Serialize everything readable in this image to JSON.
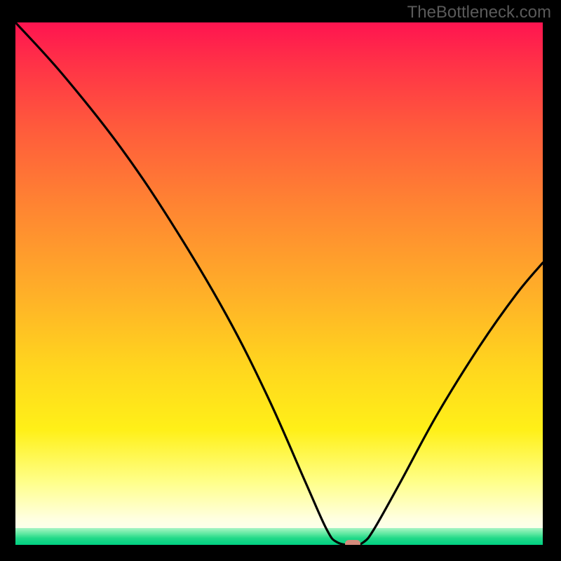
{
  "attribution": "TheBottleneck.com",
  "chart_data": {
    "type": "line",
    "title": "",
    "xlabel": "",
    "ylabel": "",
    "xlim": [
      0,
      100
    ],
    "ylim": [
      0,
      100
    ],
    "curve": [
      {
        "x": 0,
        "y": 100
      },
      {
        "x": 9,
        "y": 90
      },
      {
        "x": 20,
        "y": 76
      },
      {
        "x": 30,
        "y": 61
      },
      {
        "x": 40,
        "y": 44
      },
      {
        "x": 48,
        "y": 28
      },
      {
        "x": 55,
        "y": 12
      },
      {
        "x": 59,
        "y": 3
      },
      {
        "x": 61,
        "y": 0.5
      },
      {
        "x": 64,
        "y": 0
      },
      {
        "x": 66,
        "y": 0.5
      },
      {
        "x": 68,
        "y": 3
      },
      {
        "x": 73,
        "y": 12
      },
      {
        "x": 80,
        "y": 25
      },
      {
        "x": 88,
        "y": 38
      },
      {
        "x": 95,
        "y": 48
      },
      {
        "x": 100,
        "y": 54
      }
    ],
    "marker": {
      "x": 64,
      "y": 0
    },
    "background": {
      "top_color": "#ff1450",
      "mid_color": "#ffd61e",
      "low_color": "#ffffe0",
      "base_band_color": "#00d082"
    }
  }
}
